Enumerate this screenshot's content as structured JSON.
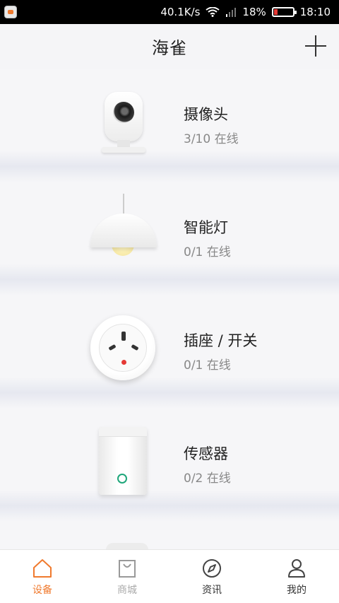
{
  "status_bar": {
    "network_speed": "40.1K/s",
    "battery_percent": "18%",
    "battery_level": 0.18,
    "time": "18:10"
  },
  "header": {
    "title": "海雀"
  },
  "devices": [
    {
      "name": "摄像头",
      "status": "3/10 在线",
      "icon": "camera-icon"
    },
    {
      "name": "智能灯",
      "status": "0/1 在线",
      "icon": "lamp-icon"
    },
    {
      "name": "插座 / 开关",
      "status": "0/1 在线",
      "icon": "socket-icon"
    },
    {
      "name": "传感器",
      "status": "0/2 在线",
      "icon": "sensor-icon"
    }
  ],
  "tabs": [
    {
      "label": "设备",
      "icon": "home-icon",
      "active": true
    },
    {
      "label": "商城",
      "icon": "shopping-bag-icon",
      "active": false
    },
    {
      "label": "资讯",
      "icon": "compass-icon",
      "active": false
    },
    {
      "label": "我的",
      "icon": "user-icon",
      "active": false
    }
  ],
  "colors": {
    "accent": "#f07a2e",
    "background": "#f5f5f7",
    "battery_low": "#e53935"
  }
}
